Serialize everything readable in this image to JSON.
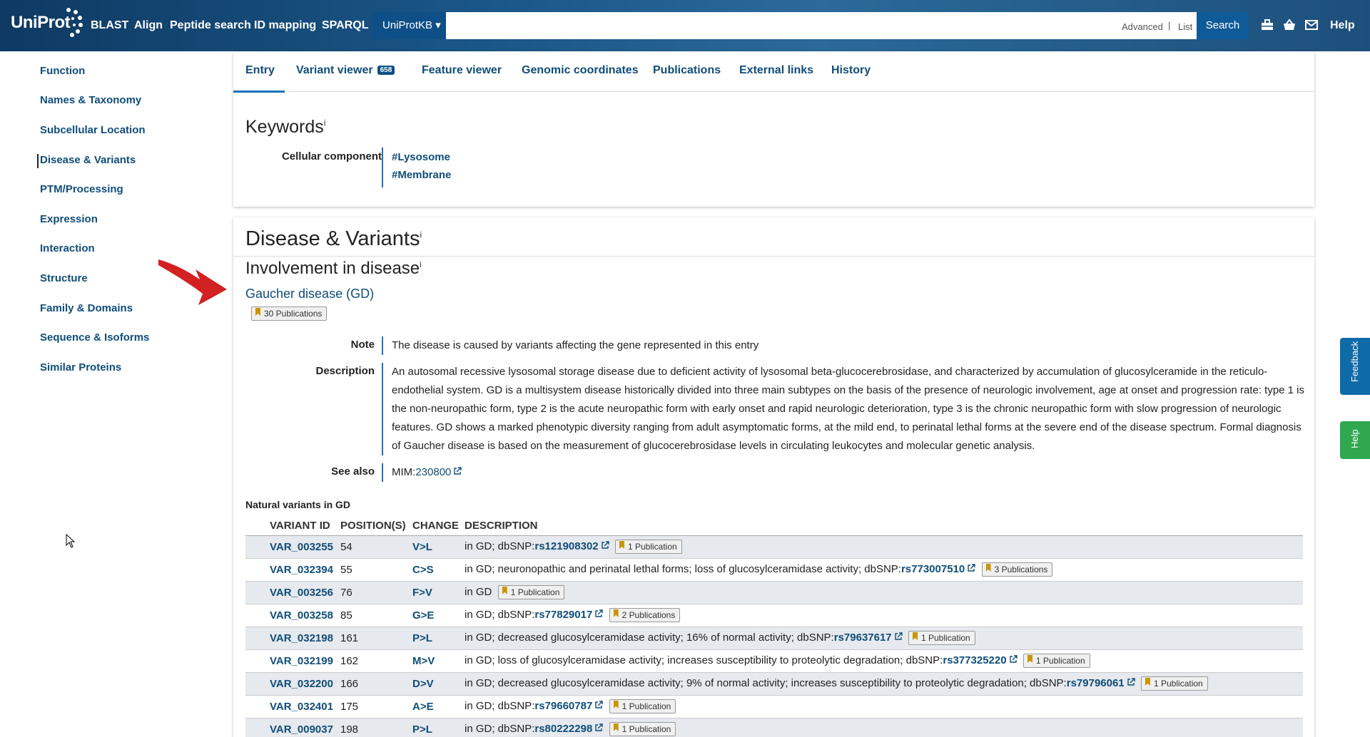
{
  "header": {
    "logo": "UniProt",
    "nav": [
      "BLAST",
      "Align",
      "Peptide search",
      "ID mapping",
      "SPARQL"
    ],
    "db_select": "UniProtKB ▾",
    "advanced": "Advanced",
    "list": "List",
    "search_label": "Search",
    "help": "Help",
    "icons": [
      "toolbox-icon",
      "basket-icon",
      "mail-icon"
    ]
  },
  "sidebar": {
    "items": [
      "Function",
      "Names & Taxonomy",
      "Subcellular Location",
      "Disease & Variants",
      "PTM/Processing",
      "Expression",
      "Interaction",
      "Structure",
      "Family & Domains",
      "Sequence & Isoforms",
      "Similar Proteins"
    ],
    "active": "Disease & Variants"
  },
  "tabs": {
    "entry": "Entry",
    "variant_viewer": "Variant viewer",
    "variant_count": "658",
    "feature_viewer": "Feature viewer",
    "genomic_coordinates": "Genomic coordinates",
    "publications": "Publications",
    "external_links": "External links",
    "history": "History"
  },
  "keywords": {
    "title": "Keywords",
    "info": "i",
    "label": "Cellular component",
    "values": [
      "#Lysosome",
      "#Membrane"
    ]
  },
  "disease_section": {
    "title": "Disease & Variants",
    "info": "i",
    "subtitle": "Involvement in disease",
    "disease_name": "Gaucher disease (GD)",
    "publications_badge": "30 Publications",
    "note_label": "Note",
    "note": "The disease is caused by variants affecting the gene represented in this entry",
    "description_label": "Description",
    "description": "An autosomal recessive lysosomal storage disease due to deficient activity of lysosomal beta-glucocerebrosidase, and characterized by accumulation of glucosylceramide in the reticulo-endothelial system. GD is a multisystem disease historically divided into three main subtypes on the basis of the presence of neurologic involvement, age at onset and progression rate: type 1 is the non-neuropathic form, type 2 is the acute neuropathic form with early onset and rapid neurologic deterioration, type 3 is the chronic neuropathic form with slow progression of neurologic features. GD shows a marked phenotypic diversity ranging from adult asymptomatic forms, at the mild end, to perinatal lethal forms at the severe end of the disease spectrum. Formal diagnosis of Gaucher disease is based on the measurement of glucocerebrosidase levels in circulating leukocytes and molecular genetic analysis.",
    "see_also_label": "See also",
    "see_also_prefix": "MIM:",
    "see_also_link": "230800"
  },
  "variants": {
    "caption": "Natural variants in GD",
    "headers": [
      "VARIANT ID",
      "POSITION(S)",
      "CHANGE",
      "DESCRIPTION"
    ],
    "rows": [
      {
        "id": "VAR_003255",
        "pos": "54",
        "change": "V>L",
        "desc": "in GD; dbSNP:",
        "snp": "rs121908302",
        "pubs": "1 Publication"
      },
      {
        "id": "VAR_032394",
        "pos": "55",
        "change": "C>S",
        "desc": "in GD; neuronopathic and perinatal lethal forms; loss of glucosylceramidase activity; dbSNP:",
        "snp": "rs773007510",
        "pubs": "3 Publications"
      },
      {
        "id": "VAR_003256",
        "pos": "76",
        "change": "F>V",
        "desc": "in GD",
        "snp": "",
        "pubs": "1 Publication"
      },
      {
        "id": "VAR_003258",
        "pos": "85",
        "change": "G>E",
        "desc": "in GD; dbSNP:",
        "snp": "rs77829017",
        "pubs": "2 Publications"
      },
      {
        "id": "VAR_032198",
        "pos": "161",
        "change": "P>L",
        "desc": "in GD; decreased glucosylceramidase activity; 16% of normal activity; dbSNP:",
        "snp": "rs79637617",
        "pubs": "1 Publication"
      },
      {
        "id": "VAR_032199",
        "pos": "162",
        "change": "M>V",
        "desc": "in GD; loss of glucosylceramidase activity; increases susceptibility to proteolytic degradation; dbSNP:",
        "snp": "rs377325220",
        "pubs": "1 Publication"
      },
      {
        "id": "VAR_032200",
        "pos": "166",
        "change": "D>V",
        "desc": "in GD; decreased glucosylceramidase activity; 9% of normal activity; increases susceptibility to proteolytic degradation; dbSNP:",
        "snp": "rs79796061",
        "pubs": "1 Publication"
      },
      {
        "id": "VAR_032401",
        "pos": "175",
        "change": "A>E",
        "desc": "in GD; dbSNP:",
        "snp": "rs79660787",
        "pubs": "1 Publication"
      },
      {
        "id": "VAR_009037",
        "pos": "198",
        "change": "P>L",
        "desc": "in GD; dbSNP:",
        "snp": "rs80222298",
        "pubs": "1 Publication"
      }
    ]
  },
  "floating": {
    "feedback": "Feedback",
    "help": "Help"
  },
  "colors": {
    "header_dark": "#0e3a63",
    "link": "#0f4d7a",
    "accent_bar": "#1d72b8",
    "feedback": "#0f6aa8",
    "help": "#2fa84f",
    "annotation_arrow": "#d32020"
  }
}
